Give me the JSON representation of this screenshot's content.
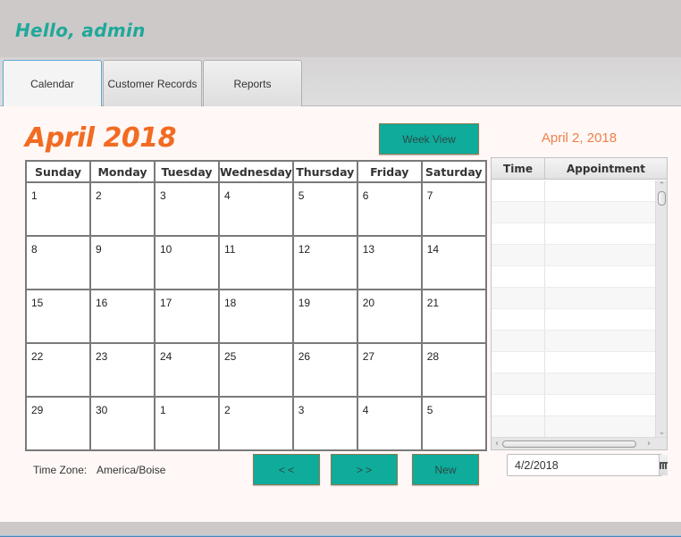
{
  "header": {
    "greeting": "Hello, admin"
  },
  "tabs": [
    {
      "label": "Calendar",
      "active": true
    },
    {
      "label": "Customer Records",
      "active": false
    },
    {
      "label": "Reports",
      "active": false
    }
  ],
  "calendar": {
    "month_title": "April 2018",
    "week_view_label": "Week View",
    "weekdays": [
      "Sunday",
      "Monday",
      "Tuesday",
      "Wednesday",
      "Thursday",
      "Friday",
      "Saturday"
    ],
    "weeks": [
      [
        "1",
        "2",
        "3",
        "4",
        "5",
        "6",
        "7"
      ],
      [
        "8",
        "9",
        "10",
        "11",
        "12",
        "13",
        "14"
      ],
      [
        "15",
        "16",
        "17",
        "18",
        "19",
        "20",
        "21"
      ],
      [
        "22",
        "23",
        "24",
        "25",
        "26",
        "27",
        "28"
      ],
      [
        "29",
        "30",
        "1",
        "2",
        "3",
        "4",
        "5"
      ]
    ],
    "prev_label": "< <",
    "next_label": "> >",
    "new_label": "New",
    "timezone_label": "Time Zone:",
    "timezone_value": "America/Boise"
  },
  "appointments": {
    "selected_date": "April 2, 2018",
    "columns": [
      "Time",
      "Appointment"
    ],
    "rows": [],
    "date_picker_value": "4/2/2018"
  },
  "colors": {
    "accent_teal": "#0fab9b",
    "title_orange": "#f26b22",
    "greeting_teal": "#1fa89a"
  }
}
